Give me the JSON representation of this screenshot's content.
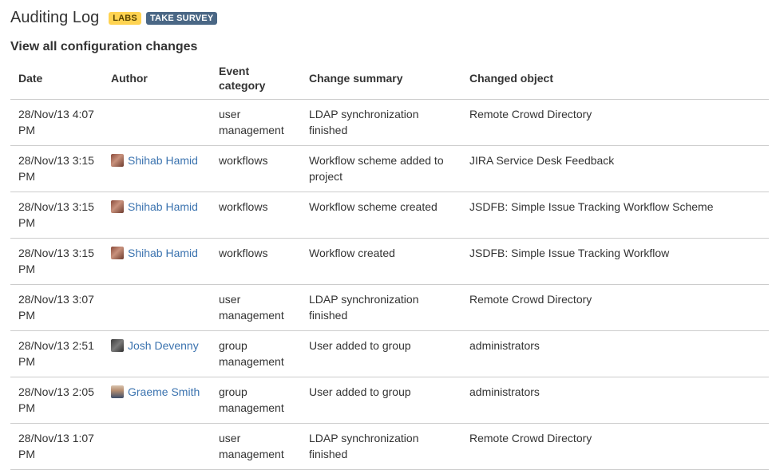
{
  "header": {
    "title": "Auditing Log",
    "badges": {
      "labs": "LABS",
      "survey": "TAKE SURVEY"
    }
  },
  "section": {
    "heading": "View all configuration changes"
  },
  "table": {
    "columns": {
      "date": "Date",
      "author": "Author",
      "category": "Event category",
      "summary": "Change summary",
      "object": "Changed object"
    },
    "rows": [
      {
        "date": "28/Nov/13 4:07 PM",
        "author": "",
        "category": "user management",
        "summary": "LDAP synchronization finished",
        "object": "Remote Crowd Directory"
      },
      {
        "date": "28/Nov/13 3:15 PM",
        "author": "Shihab Hamid",
        "category": "workflows",
        "summary": "Workflow scheme added to project",
        "object": "JIRA Service Desk Feedback"
      },
      {
        "date": "28/Nov/13 3:15 PM",
        "author": "Shihab Hamid",
        "category": "workflows",
        "summary": "Workflow scheme created",
        "object": "JSDFB: Simple Issue Tracking Workflow Scheme"
      },
      {
        "date": "28/Nov/13 3:15 PM",
        "author": "Shihab Hamid",
        "category": "workflows",
        "summary": "Workflow created",
        "object": "JSDFB: Simple Issue Tracking Workflow"
      },
      {
        "date": "28/Nov/13 3:07 PM",
        "author": "",
        "category": "user management",
        "summary": "LDAP synchronization finished",
        "object": "Remote Crowd Directory"
      },
      {
        "date": "28/Nov/13 2:51 PM",
        "author": "Josh Devenny",
        "category": "group management",
        "summary": "User added to group",
        "object": "administrators"
      },
      {
        "date": "28/Nov/13 2:05 PM",
        "author": "Graeme Smith",
        "category": "group management",
        "summary": "User added to group",
        "object": "administrators"
      },
      {
        "date": "28/Nov/13 1:07 PM",
        "author": "",
        "category": "user management",
        "summary": "LDAP synchronization finished",
        "object": "Remote Crowd Directory"
      }
    ]
  },
  "colors": {
    "link": "#3b73af",
    "labs_badge_bg": "#ffd351",
    "survey_badge_bg": "#4a6785",
    "row_border": "#cccccc"
  }
}
